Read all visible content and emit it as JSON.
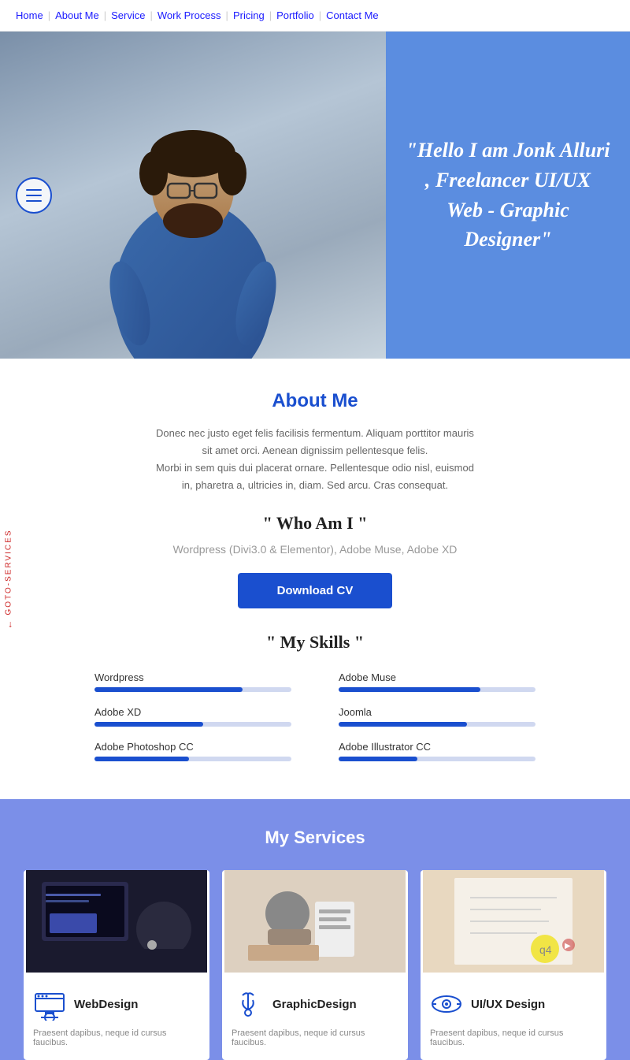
{
  "nav": {
    "items": [
      {
        "label": "Home",
        "href": "#"
      },
      {
        "label": "About Me",
        "href": "#"
      },
      {
        "label": "Service",
        "href": "#"
      },
      {
        "label": "Work Process",
        "href": "#"
      },
      {
        "label": "Pricing",
        "href": "#"
      },
      {
        "label": "Portfolio",
        "href": "#"
      },
      {
        "label": "Contact Me",
        "href": "#"
      }
    ]
  },
  "hero": {
    "quote": "\"Hello I am Jonk Alluri , Freelancer UI/UX Web - Graphic Designer\"",
    "bg_color": "#5b8de0"
  },
  "about": {
    "title": "About Me",
    "description1": "Donec nec justo eget felis facilisis fermentum. Aliquam porttitor mauris sit amet orci. Aenean dignissim pellentesque felis.",
    "description2": "Morbi in sem quis dui placerat ornare. Pellentesque odio nisl, euismod in, pharetra a, ultricies in, diam. Sed arcu. Cras consequat.",
    "who_am_i": "\" Who Am I \"",
    "tools": "Wordpress (Divi3.0 & Elementor), Adobe Muse, Adobe XD",
    "download_btn": "Download CV",
    "my_skills": "\" My Skills \"",
    "goto_label": "GOTO-SERVICES"
  },
  "skills": [
    {
      "name": "Wordpress",
      "pct": 75
    },
    {
      "name": "Adobe Muse",
      "pct": 72
    },
    {
      "name": "Adobe XD",
      "pct": 55
    },
    {
      "name": "Joomla",
      "pct": 65
    },
    {
      "name": "Adobe Photoshop CC",
      "pct": 48
    },
    {
      "name": "Adobe Illustrator CC",
      "pct": 40
    }
  ],
  "services": {
    "title": "My Services",
    "cards": [
      {
        "name": "WebDesign",
        "icon": "webdesign",
        "desc": "Praesent dapibus, neque id cursus faucibus.",
        "bg": "dark"
      },
      {
        "name": "GraphicDesign",
        "icon": "graphicdesign",
        "desc": "Praesent dapibus, neque id cursus faucibus.",
        "bg": "light"
      },
      {
        "name": "UI/UX Design",
        "icon": "uiux",
        "desc": "Praesent dapibus, neque id cursus faucibus.",
        "bg": "cream"
      }
    ]
  }
}
